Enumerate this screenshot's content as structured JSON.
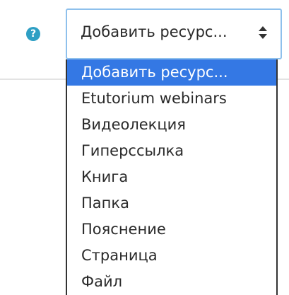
{
  "help": {
    "icon": "question-circle-icon",
    "glyph": "?",
    "color": "#2e9fc4"
  },
  "select": {
    "value": "Добавить ресурс...",
    "arrow_icon": "up-down-arrows-icon",
    "focus_border_color": "#8ec0ec"
  },
  "dropdown": {
    "highlight_color": "#3478e4",
    "options": [
      "Добавить ресурс...",
      "Etutorium webinars",
      "Видеолекция",
      "Гиперссылка",
      "Книга",
      "Папка",
      "Пояснение",
      "Страница",
      "Файл"
    ],
    "selected_index": 0
  }
}
